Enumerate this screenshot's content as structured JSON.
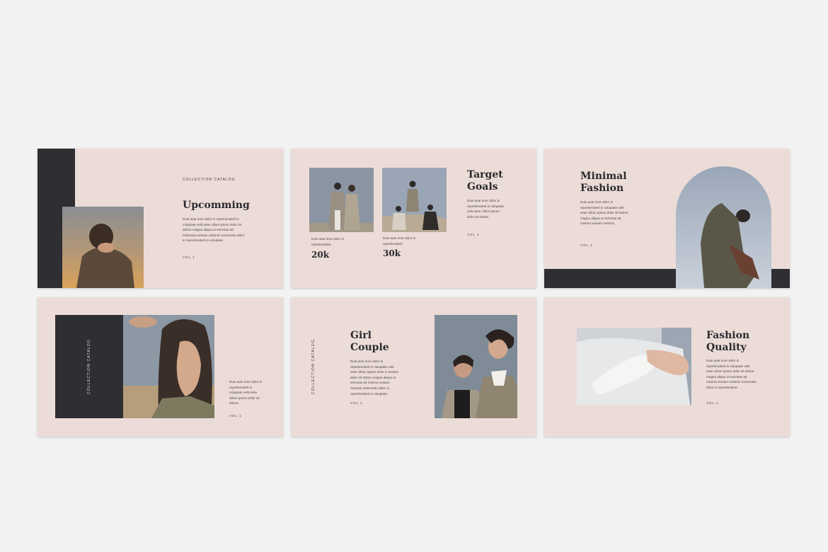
{
  "slides": {
    "s1": {
      "kicker": "COLLECTION CATALOG",
      "title": "Upcomming",
      "body": "Duis aute irure dolor in reprehenderit in voluptate velit esse cillum ipsum dolor sit dolore magna aliqua ut enimsas ad minimaca veniam nostrud consectetu dolor in reprehenderit in voluptate.",
      "vol": "VOL 1"
    },
    "s2": {
      "title": "Target\nGoals",
      "body": "Duis aute irure dolor in reprehenderit in voluptate velit esse cillum ipsum dolor sit dolore.",
      "stat1_caption": "Duis aute irure dolor in reprehenderit.",
      "stat1_value": "20k",
      "stat2_caption": "Duis aute irure dolor in reprehenderit.",
      "stat2_value": "30k",
      "vol": "VOL 1"
    },
    "s3": {
      "title": "Minimal\nFashion",
      "body": "Duis aute irure dolor in reprehenderit in voluptate velit esse cillum ipsum dolor sit dolore magna aliqua ut enimsas ad minima veniam nostrud.",
      "vol": "VOL 1"
    },
    "s4": {
      "vertical": "COLLECTION CATALOG",
      "body": "Duis aute irure dolor in reprehenderit in voluptate velit esse cillum ipsum dolor sit dolore.",
      "vol": "VOL 1"
    },
    "s5": {
      "vertical": "COLLECTION CATALOG",
      "title": "Girl\nCouple",
      "body": "Duis aute irure dolor in reprehenderit in voluptate velit esse cillum ipsum dolor in tempor dolor sit dolore magna aliqua ut enimsas ad minima veniam nostrud consectetu dolor in reprehenderit in voluptate.",
      "vol": "VOL 1"
    },
    "s6": {
      "title": "Fashion\nQuality",
      "body": "Duis aute irure dolor in reprehenderit in voluptate velit esse cillum ipsum dolor sit dolore magna aliqua ut enimsas ad minima veniam nostrud consectetu dolor in reprehenderit.",
      "vol": "VOL 1"
    }
  },
  "colors": {
    "background": "#f2f2f2",
    "slide": "#ecdcd8",
    "dark_block": "#2f2e33",
    "title": "#2a2a2e"
  }
}
